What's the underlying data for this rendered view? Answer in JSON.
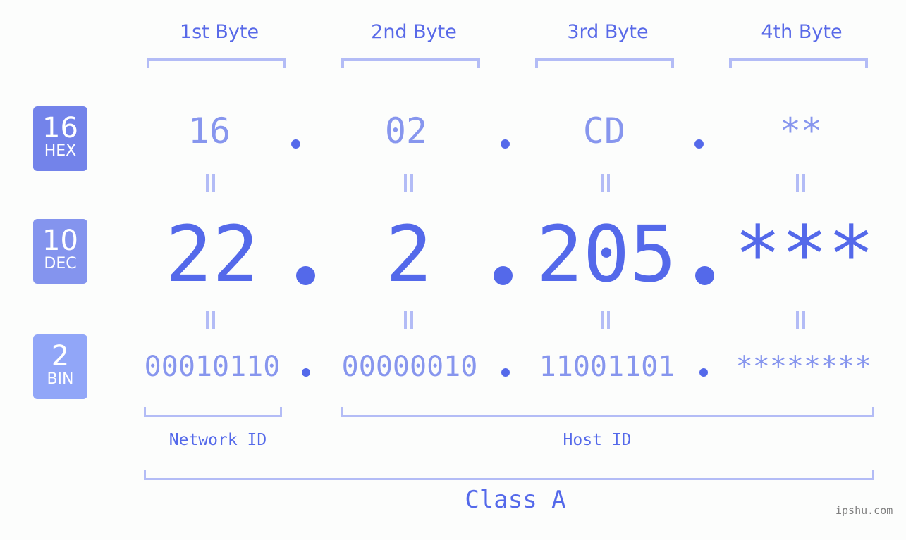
{
  "byte_headers": [
    "1st Byte",
    "2nd Byte",
    "3rd Byte",
    "4th Byte"
  ],
  "badges": {
    "hex": {
      "number": "16",
      "label": "HEX",
      "color": "#7383ea"
    },
    "dec": {
      "number": "10",
      "label": "DEC",
      "color": "#8494ee"
    },
    "bin": {
      "number": "2",
      "label": "BIN",
      "color": "#91a6f8"
    }
  },
  "hex_values": [
    "16",
    "02",
    "CD",
    "**"
  ],
  "dec_values": [
    "22",
    "2",
    "205",
    "***"
  ],
  "bin_values": [
    "00010110",
    "00000010",
    "11001101",
    "********"
  ],
  "separator": ".",
  "network_id_label": "Network ID",
  "host_id_label": "Host ID",
  "class_label": "Class A",
  "watermark": "ipshu.com",
  "colors": {
    "primary": "#5469ea",
    "secondary": "#8796ee",
    "bracket": "#b3bcf6",
    "background": "#fcfdfc"
  }
}
